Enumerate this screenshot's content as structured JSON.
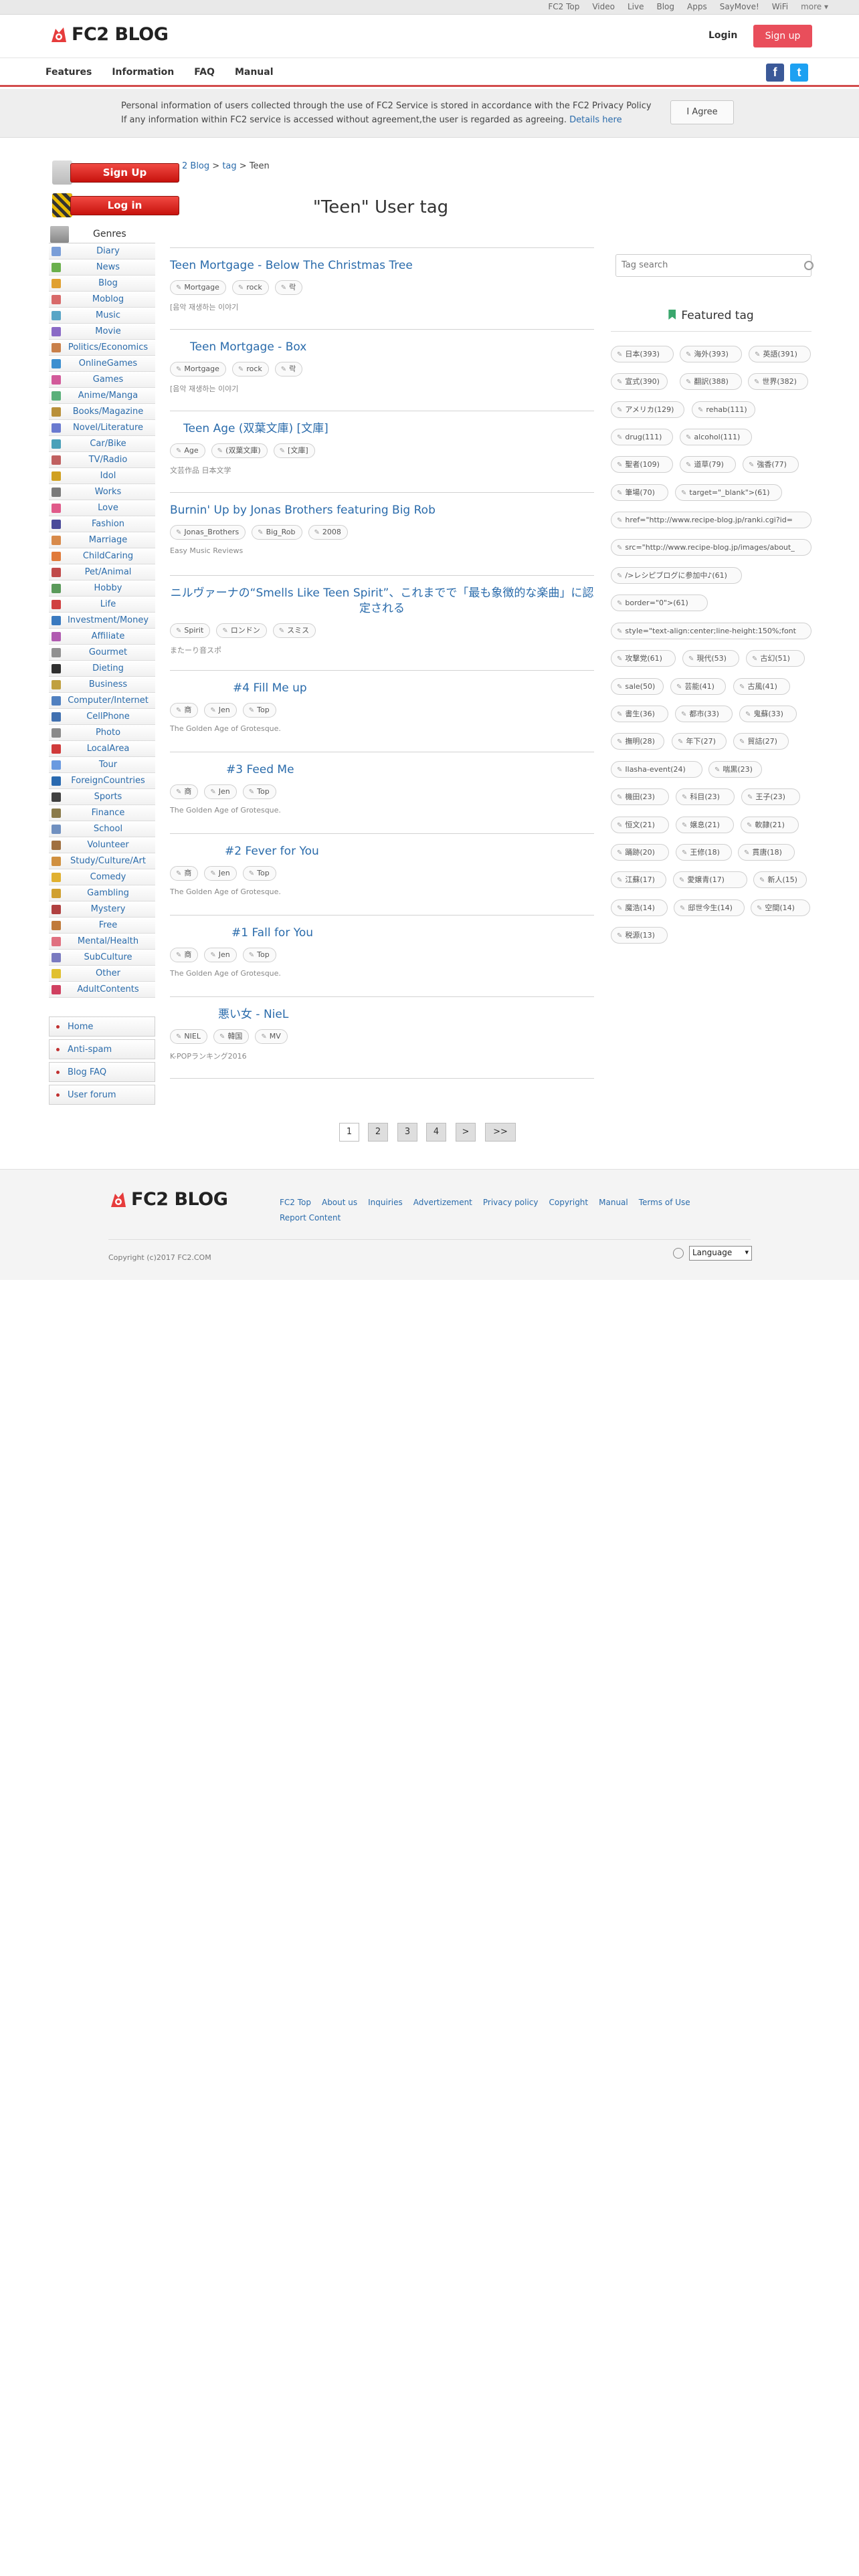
{
  "topbar": {
    "links": [
      "FC2 Top",
      "Video",
      "Live",
      "Blog",
      "Apps",
      "SayMove!",
      "WiFi",
      "more"
    ]
  },
  "header": {
    "logo": "FC2 BLOG",
    "login": "Login",
    "signup": "Sign up"
  },
  "nav": {
    "items": [
      "Features",
      "Information",
      "FAQ",
      "Manual"
    ],
    "facebook": "f",
    "twitter": "t"
  },
  "notice": {
    "line1": "Personal information of users collected through the use of FC2 Service is stored in accordance with the FC2 Privacy Policy",
    "line2": "If any information within FC2 service is accessed without agreement,the user is regarded as agreeing.",
    "details": "Details here",
    "agree": "I Agree"
  },
  "left": {
    "signup": "Sign Up",
    "login": "Log in",
    "genres_title": "Genres",
    "genres": [
      "Diary",
      "News",
      "Blog",
      "Moblog",
      "Music",
      "Movie",
      "Politics/Economics",
      "OnlineGames",
      "Games",
      "Anime/Manga",
      "Books/Magazine",
      "Novel/Literature",
      "Car/Bike",
      "TV/Radio",
      "Idol",
      "Works",
      "Love",
      "Fashion",
      "Marriage",
      "ChildCaring",
      "Pet/Animal",
      "Hobby",
      "Life",
      "Investment/Money",
      "Affiliate",
      "Gourmet",
      "Dieting",
      "Business",
      "Computer/Internet",
      "CellPhone",
      "Photo",
      "LocalArea",
      "Tour",
      "ForeignCountries",
      "Sports",
      "Finance",
      "School",
      "Volunteer",
      "Study/Culture/Art",
      "Comedy",
      "Gambling",
      "Mystery",
      "Free",
      "Mental/Health",
      "SubCulture",
      "Other",
      "AdultContents"
    ],
    "links": [
      "Home",
      "Anti-spam",
      "Blog FAQ",
      "User forum"
    ]
  },
  "breadcrumb": {
    "a": "2 Blog",
    "sep1": " > ",
    "b": "tag",
    "sep2": " > ",
    "c": "Teen"
  },
  "page_title": "\"Teen\" User tag",
  "posts": [
    {
      "title": "Teen Mortgage - Below The Christmas Tree",
      "tags": [
        "Mortgage",
        "rock",
        "락"
      ],
      "blog": "[음악 재생하는 이야기"
    },
    {
      "title": "Teen Mortgage - Box",
      "tags": [
        "Mortgage",
        "rock",
        "락"
      ],
      "blog": "[음악 재생하는 이야기"
    },
    {
      "title": "Teen Age (双葉文庫) [文庫]",
      "tags": [
        "Age",
        "(双葉文庫)",
        "[文庫]"
      ],
      "blog": "文芸作品 日本文学"
    },
    {
      "title": "Burnin' Up by Jonas Brothers featuring Big Rob",
      "tags": [
        "Jonas_Brothers",
        "Big_Rob",
        "2008"
      ],
      "blog": "Easy Music Reviews"
    },
    {
      "title": "ニルヴァーナの“Smells Like Teen Spirit”、これまでで「最も象徴的な楽曲」に認定される",
      "tags": [
        "Spirit",
        "ロンドン",
        "スミス"
      ],
      "blog": "またーり音スポ"
    },
    {
      "title": "#4 Fill Me up",
      "tags": [
        "商",
        "Jen",
        "Top"
      ],
      "blog": "The Golden Age of Grotesque."
    },
    {
      "title": "#3 Feed Me",
      "tags": [
        "商",
        "Jen",
        "Top"
      ],
      "blog": "The Golden Age of Grotesque."
    },
    {
      "title": "#2 Fever for You",
      "tags": [
        "商",
        "Jen",
        "Top"
      ],
      "blog": "The Golden Age of Grotesque."
    },
    {
      "title": "#1 Fall for You",
      "tags": [
        "商",
        "Jen",
        "Top"
      ],
      "blog": "The Golden Age of Grotesque."
    },
    {
      "title": "悪い女 - NieL",
      "tags": [
        "NIEL",
        "韓国",
        "MV"
      ],
      "blog": "K-POPランキング2016"
    }
  ],
  "pagination": [
    "1",
    "2",
    "3",
    "4",
    ">",
    ">>"
  ],
  "right": {
    "search_placeholder": "Tag search",
    "featured_title": "Featured tag",
    "tags": [
      "日本(393)",
      "海外(393)",
      "英語(391)",
      "宣式(390)",
      "翻訳(388)",
      "世界(382)",
      "アメリカ(129)",
      "rehab(111)",
      "drug(111)",
      "alcohol(111)",
      "聖者(109)",
      "道草(79)",
      "強香(77)",
      "筆場(70)",
      "target=\"_blank\">(61)",
      "href=\"http://www.recipe-blog.jp/ranki.cgi?id=",
      "src=\"http://www.recipe-blog.jp/images/about_",
      "/>レシピブログに参加中♪(61)",
      "border=\"0\">(61)",
      "style=\"text-align:center;line-height:150%;font",
      "攻撃党(61)",
      "現代(53)",
      "古幻(51)",
      "sale(50)",
      "芸能(41)",
      "古風(41)",
      "書生(36)",
      "都市(33)",
      "鬼蘇(33)",
      "撫明(28)",
      "年下(27)",
      "貿詰(27)",
      "Ilasha-event(24)",
      "喘黒(23)",
      "機田(23)",
      "科目(23)",
      "王子(23)",
      "恒文(21)",
      "嬢息(21)",
      "軟隷(21)",
      "踊跡(20)",
      "王修(18)",
      "貫唐(18)",
      "江蘇(17)",
      "愛嬢青(17)",
      "新人(15)",
      "魔浩(14)",
      "邸世今生(14)",
      "空間(14)",
      "税源(13)"
    ]
  },
  "footer": {
    "logo": "FC2 BLOG",
    "links": [
      "FC2 Top",
      "About us",
      "Inquiries",
      "Advertizement",
      "Privacy policy",
      "Copyright",
      "Manual",
      "Terms of Use",
      "Report Content"
    ],
    "copyright": "Copyright (c)2017 FC2.COM",
    "language": "Language"
  }
}
